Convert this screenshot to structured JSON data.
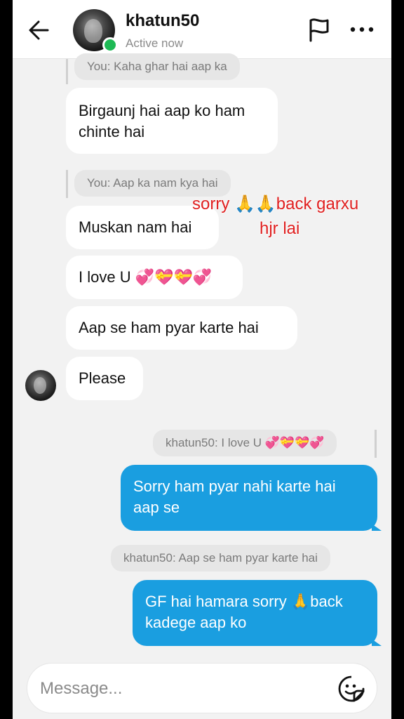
{
  "header": {
    "username": "khatun50",
    "status": "Active now"
  },
  "messages": {
    "q1": "You: Kaha ghar hai aap ka",
    "m1": "Birgaunj hai aap ko ham chinte hai",
    "q2": "You: Aap ka nam kya hai",
    "m2": "Muskan nam hai",
    "m3": "I love U 💞💝💝💞",
    "m4": "Aap se ham pyar karte hai",
    "m5": "Please",
    "q3": "khatun50: I love U 💞💝💝💞",
    "o1": "Sorry ham pyar nahi karte hai aap se",
    "q4": "khatun50: Aap se ham pyar karte hai",
    "o2": "GF hai hamara sorry 🙏back kadege aap ko"
  },
  "overlay": {
    "line1": "sorry 🙏🙏back garxu",
    "line2": "hjr lai"
  },
  "composer": {
    "placeholder": "Message..."
  },
  "icons": {
    "back": "arrow-left-icon",
    "flag": "flag-icon",
    "more": "more-horizontal-icon",
    "sticker": "sticker-icon"
  },
  "colors": {
    "outgoing_bubble": "#1a9ee0",
    "incoming_bubble": "#ffffff",
    "online": "#1db954",
    "overlay_text": "#e02020"
  }
}
